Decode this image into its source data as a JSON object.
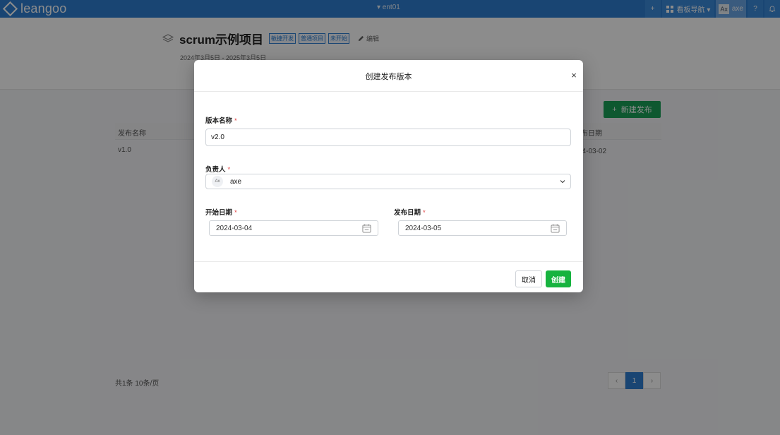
{
  "topbar": {
    "logo_text": "leangoo",
    "team_name": "▾ ent01",
    "add_label": "+",
    "board_nav_label": "看板导航 ▾",
    "avatar_initials": "Ax",
    "user_name": "axe",
    "help_label": "?"
  },
  "project": {
    "title": "scrum示例项目",
    "tags": [
      "敏捷开发",
      "普通项目",
      "未开始"
    ],
    "edit_label": "编辑",
    "date_range": "2024年3月5日 - 2025年3月5日"
  },
  "releases": {
    "new_button_label": "新建发布",
    "columns": [
      "发布名称",
      "布日期"
    ],
    "rows": [
      {
        "name": "v1.0",
        "date": "24-03-02"
      }
    ],
    "pager_total": "共1条 10条/页",
    "prev_label": "‹",
    "current_page": "1",
    "next_label": "›"
  },
  "modal": {
    "title": "创建发布版本",
    "close_label": "×",
    "fields": {
      "version_name": {
        "label": "版本名称",
        "value": "v2.0"
      },
      "owner": {
        "label": "负责人",
        "avatar": "Ax",
        "value": "axe"
      },
      "start_date": {
        "label": "开始日期",
        "value": "2024-03-04"
      },
      "release_date": {
        "label": "发布日期",
        "value": "2024-03-05"
      }
    },
    "required_mark": "*",
    "cancel_label": "取消",
    "create_label": "创建"
  },
  "colors": {
    "topbar": "#2f7fd1",
    "create_button": "#17b33f",
    "new_release_button": "#1aa058",
    "required": "#e04040"
  }
}
